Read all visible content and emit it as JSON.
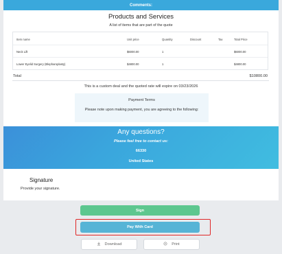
{
  "comments": {
    "label": "Comments:"
  },
  "products": {
    "title": "Products and Services",
    "subtitle": "A list of items that are part of the quote",
    "columns": [
      "Item name",
      "Unit price",
      "Quantity",
      "Discount",
      "Tax",
      "Total Price"
    ],
    "rows": [
      {
        "name": "Neck Lift",
        "unit_price": "$6000.00",
        "quantity": "1",
        "discount": "",
        "tax": "",
        "total": "$6000.00"
      },
      {
        "name": "Lower Eyelid Surgery (Blepharoplasty)",
        "unit_price": "$4800.00",
        "quantity": "1",
        "discount": "",
        "tax": "",
        "total": "$4800.00"
      }
    ]
  },
  "summary": {
    "total_label": "Total",
    "total_value": "$10800.00"
  },
  "notice": "This is a custom deal and the quoted rate will expire on 03/23/2026",
  "terms": {
    "title": "Payment Terms",
    "text": "Please note upon making payment, you are agreeing to the following:"
  },
  "questions": {
    "title": "Any questions?",
    "subtitle": "Please feel free to contact us:",
    "zip": "66330",
    "country": "United States"
  },
  "signature": {
    "title": "Signature",
    "subtitle": "Provide your signature."
  },
  "actions": {
    "sign": "Sign",
    "pay": "Pay With Card",
    "download": "Download",
    "print": "Print",
    "download_icon": "download-icon",
    "print_icon": "print-icon"
  },
  "colors": {
    "accent_blue": "#3aa8dc",
    "sign_green": "#5dc78f",
    "pay_blue": "#56b4d6",
    "highlight_red": "#e02525"
  }
}
